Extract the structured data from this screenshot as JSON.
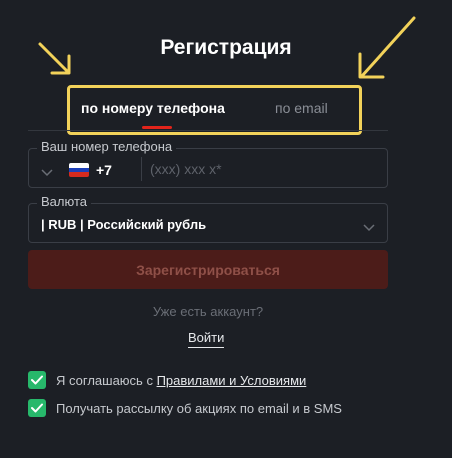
{
  "header": {
    "title": "Регистрация"
  },
  "tabs": [
    {
      "label": "по номеру телефона",
      "active": true
    },
    {
      "label": "по email",
      "active": false
    }
  ],
  "phone": {
    "label": "Ваш номер телефона",
    "country_flag": "russia-flag-icon",
    "code": "+7",
    "placeholder": "(xxx) xxx x*",
    "value": ""
  },
  "currency": {
    "label": "Валюта",
    "selected": "| RUB | Российский рубль"
  },
  "register_button": {
    "label": "Зарегистрироваться"
  },
  "login": {
    "prompt": "Уже есть аккаунт?",
    "link_label": "Войти"
  },
  "agreements": [
    {
      "checked": true,
      "text_before": "Я соглашаюсь с ",
      "link": "Правилами и Условиями"
    },
    {
      "checked": true,
      "text": "Получать рассылку об акциях по email и в SMS"
    }
  ],
  "colors": {
    "background": "#1c1f25",
    "accent_red": "#e2241b",
    "button_bg": "#4c1c19",
    "highlight_yellow": "#f2d25a",
    "check_green": "#27b86b"
  }
}
